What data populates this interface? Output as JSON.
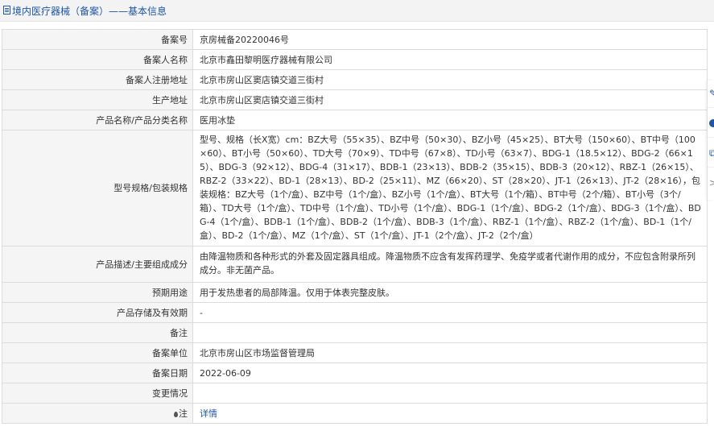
{
  "header": {
    "title": "境内医疗器械（备案）——基本信息"
  },
  "rows": [
    {
      "label": "备案号",
      "value": "京房械备20220046号"
    },
    {
      "label": "备案人名称",
      "value": "北京市鑫田黎明医疗器械有限公司"
    },
    {
      "label": "备案人注册地址",
      "value": "北京市房山区窦店镇交道三街村"
    },
    {
      "label": "生产地址",
      "value": "北京市房山区窦店镇交道三街村"
    },
    {
      "label": "产品名称/产品分类名称",
      "value": "医用冰垫"
    },
    {
      "label": "型号规格/包装规格",
      "value": "型号、规格（长X宽）cm：BZ大号（55×35）、BZ中号（50×30）、BZ小号（45×25）、BT大号（150×60）、BT中号（100×60）、BT小号（50×60）、TD大号（70×9）、TD中号（67×8）、TD小号（63×7）、BDG-1（18.5×12）、BDG-2（66×15）、BDG-3（92×12）、BDG-4（31×17）、BDB-1（23×13）、BDB-2（35×15）、BDB-3（20×12）、RBZ-1（26×15）、RBZ-2（33×22）、BD-1（28×13）、BD-2（25×11）、MZ（66×20）、ST（28×20）、JT-1（26×13）、JT-2（28×16），包装规格：BZ大号（1个/盒）、BZ中号（1个/盒）、BZ小号（1个/盒）、BT大号（1个/箱）、BT中号（2个/箱）、BT小号（3个/箱）、TD大号（1个/盒）、TD中号（1个/盒）、TD小号（1个/盒）、BDG-1（1个/盒）、BDG-2（1个/盒）、BDG-3（1个/盒）、BDG-4（1个/盒）、BDB-1（1个/盒）、BDB-2（1个/盒）、BDB-3（1个/盒）、RBZ-1（1个/盒）、RBZ-2（1个/盒）、BD-1（1个/盒）、BD-2（1个/盒）、MZ（1个/盒）、ST（1个/盒）、JT-1（2个/盒）、JT-2（2个/盒）"
    },
    {
      "label": "产品描述/主要组成成分",
      "value": "由降温物质和各种形式的外套及固定器具组成。降温物质不应含有发挥药理学、免疫学或者代谢作用的成分，不应包含附录所列成分。非无菌产品。"
    },
    {
      "label": "预期用途",
      "value": "用于发热患者的局部降温。仅用于体表完整皮肤。"
    },
    {
      "label": "产品存储及有效期",
      "value": "-"
    },
    {
      "label": "备注",
      "value": ""
    },
    {
      "label": "备案单位",
      "value": "北京市房山区市场监督管理局"
    },
    {
      "label": "备案日期",
      "value": "2022-06-09"
    },
    {
      "label": "变更情况",
      "value": ""
    },
    {
      "label": "注",
      "value": "详情"
    }
  ],
  "sidebar": {
    "buttons": [
      {
        "icon": "edit-icon",
        "glyph": "✎"
      },
      {
        "icon": "help-icon",
        "glyph": "?"
      },
      {
        "icon": "copy-icon",
        "glyph": "⧉"
      },
      {
        "icon": "chevron-right-icon",
        "glyph": ">"
      }
    ]
  },
  "colors": {
    "accent": "#1f56a5",
    "label_bg": "#f5f5f5",
    "border": "#dcdcdc",
    "titlebar_bg": "#f3f3f3"
  }
}
